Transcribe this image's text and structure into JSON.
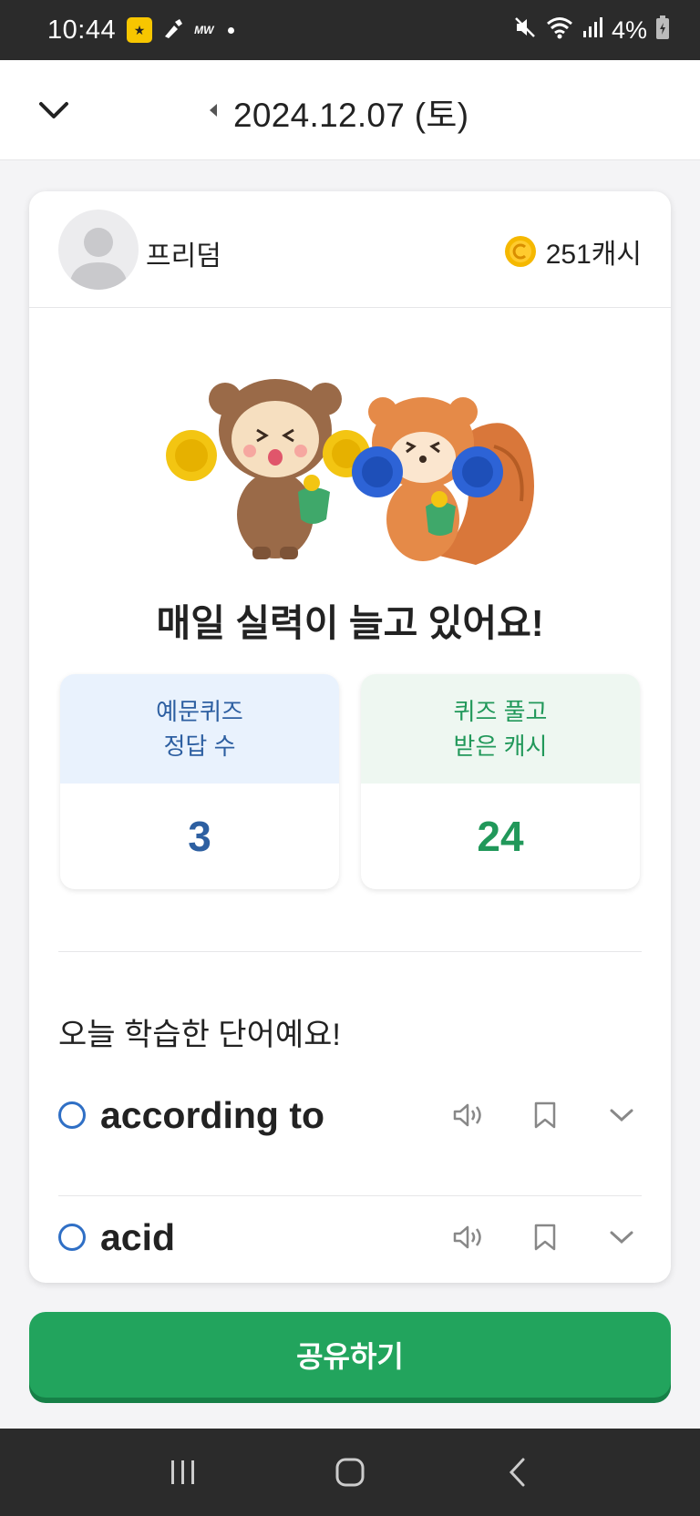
{
  "status_bar": {
    "time": "10:44",
    "small_label": "MW",
    "battery": "4%"
  },
  "header": {
    "date": "2024.12.07 (토)"
  },
  "profile": {
    "username": "프리덤",
    "cash": "251캐시"
  },
  "headline": "매일 실력이 늘고 있어요!",
  "stats": [
    {
      "label": "예문퀴즈\n정답 수",
      "value": "3",
      "color": "#2d5fa1"
    },
    {
      "label": "퀴즈 풀고\n받은 캐시",
      "value": "24",
      "color": "#21985a"
    }
  ],
  "section_title": "오늘 학습한 단어예요!",
  "words": [
    {
      "word": "according to"
    },
    {
      "word": "acid"
    }
  ],
  "share_label": "공유하기",
  "colors": {
    "accent_green": "#22a45d",
    "accent_blue": "#2d5fa1"
  }
}
